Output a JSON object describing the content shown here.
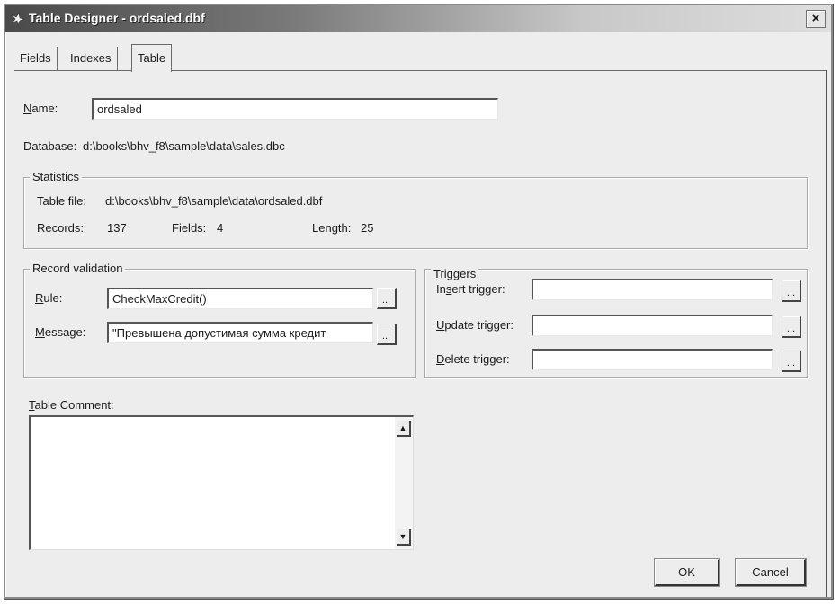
{
  "window": {
    "title": "Table Designer - ordsaled.dbf",
    "close_glyph": "×"
  },
  "tabs": [
    {
      "label": "Fields"
    },
    {
      "label": "Indexes"
    },
    {
      "label": "Table"
    }
  ],
  "active_tab": "Table",
  "name": {
    "label_first": "N",
    "label_rest": "ame:",
    "value": "ordsaled"
  },
  "database": {
    "label": "Database:",
    "value": "d:\\books\\bhv_f8\\sample\\data\\sales.dbc"
  },
  "statistics": {
    "title": "Statistics",
    "table_file_label": "Table file:",
    "table_file_value": "d:\\books\\bhv_f8\\sample\\data\\ordsaled.dbf",
    "records_label": "Records:",
    "records_value": "137",
    "fields_label": "Fields:",
    "fields_value": "4",
    "length_label": "Length:",
    "length_value": "25"
  },
  "record_validation": {
    "title": "Record validation",
    "rule_label_first": "R",
    "rule_label_rest": "ule:",
    "rule_value": "CheckMaxCredit()",
    "message_label_first": "M",
    "message_label_rest": "essage:",
    "message_value": "\"Превышена допустимая сумма кредит",
    "builder_label": "..."
  },
  "triggers": {
    "title": "Triggers",
    "insert_label_a": "In",
    "insert_label_u": "s",
    "insert_label_b": "ert trigger:",
    "insert_value": "",
    "update_label_first": "U",
    "update_label_rest": "pdate trigger:",
    "update_value": "",
    "delete_label_first": "D",
    "delete_label_rest": "elete trigger:",
    "delete_value": "",
    "builder_label": "..."
  },
  "comment": {
    "label_first": "T",
    "label_rest": "able Comment:",
    "value": "",
    "scroll_up": "▲",
    "scroll_down": "▼"
  },
  "buttons": {
    "ok": "OK",
    "cancel": "Cancel"
  },
  "icons": {
    "app_icon": "fox-icon"
  }
}
